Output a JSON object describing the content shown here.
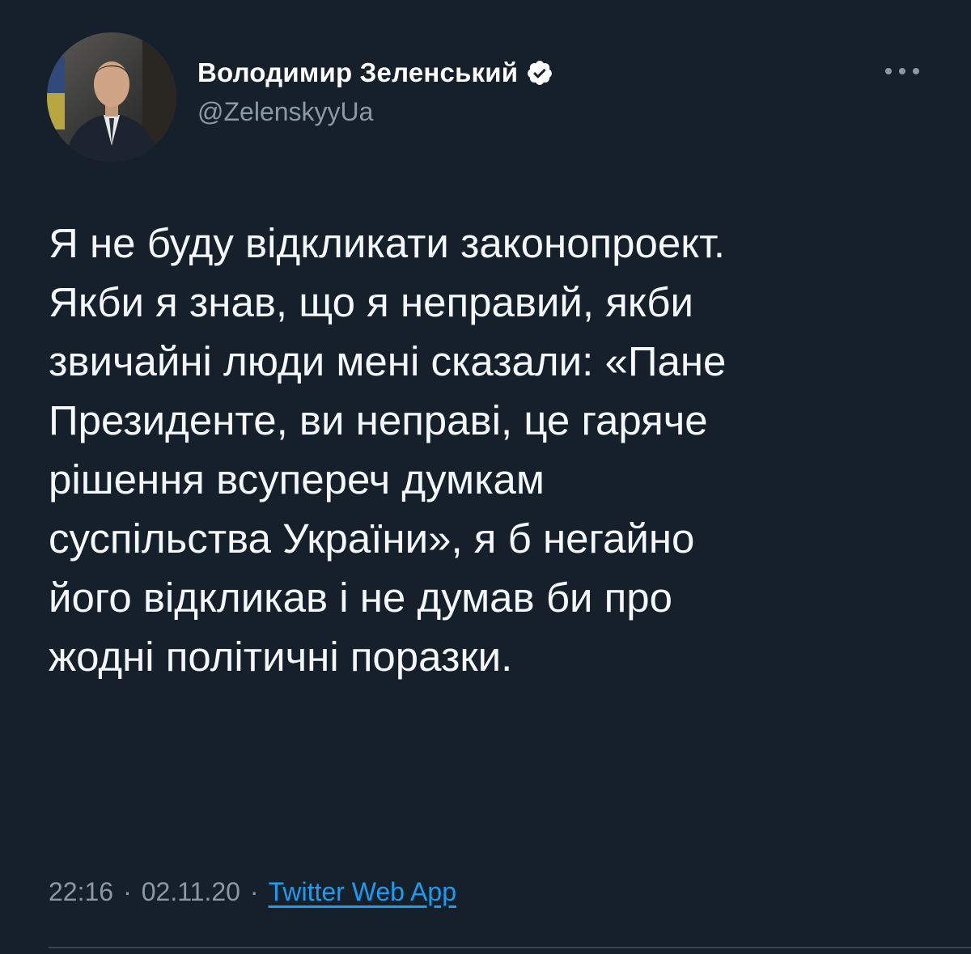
{
  "author": {
    "display_name": "Володимир Зеленський",
    "handle": "@ZelenskyyUa",
    "verified": true,
    "avatar_icon": "profile-photo"
  },
  "tweet": {
    "lines": [
      "Я не буду відкликати законопроект.",
      "Якби я знав, що я неправий, якби",
      "звичайні люди мені сказали: «Пане",
      "Президенте, ви неправі, це гаряче",
      "рішення всупереч думкам",
      "суспільства України», я б негайно",
      "його відкликав і не думав би про",
      "жодні політичні поразки."
    ],
    "time": "22:16",
    "separator": "·",
    "date": "02.11.20",
    "source": "Twitter Web App"
  },
  "icons": {
    "more": "more-horizontal-icon",
    "verified": "verified-badge-icon"
  },
  "colors": {
    "background": "#15202b",
    "text": "#f5f8fa",
    "secondary_text": "#8b98a5",
    "link": "#1d9bf0",
    "divider": "#38444d"
  }
}
